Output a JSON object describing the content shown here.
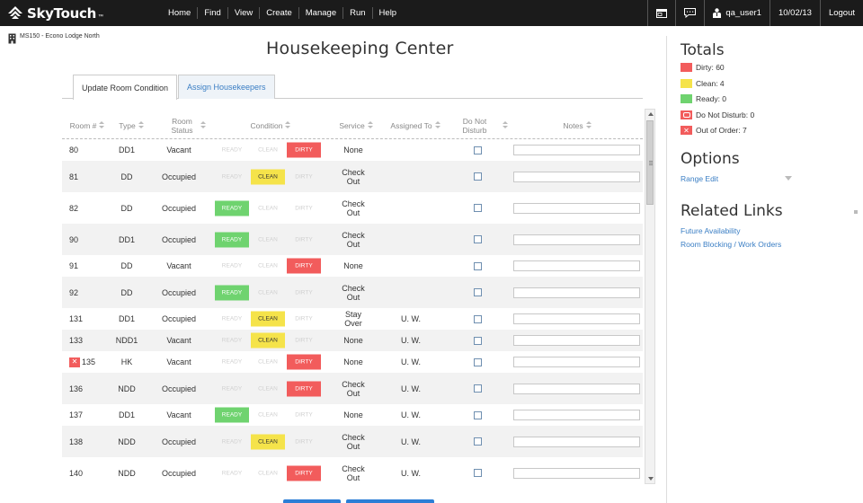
{
  "brand": {
    "name": "SkyTouch",
    "tm": "™"
  },
  "nav": [
    "Home",
    "Find",
    "View",
    "Create",
    "Manage",
    "Run",
    "Help"
  ],
  "right_nav": {
    "user": "qa_user1",
    "date": "10/02/13",
    "logout": "Logout",
    "icons": [
      "window-icon",
      "chat-icon",
      "user-icon"
    ]
  },
  "property": "MS150 - Econo Lodge North",
  "title": "Housekeeping Center",
  "tabs": [
    "Update Room Condition",
    "Assign Housekeepers"
  ],
  "headers": {
    "room": "Room #",
    "type": "Type",
    "status": "Room Status",
    "condition": "Condition",
    "service": "Service",
    "assigned": "Assigned To",
    "dnd": "Do Not Disturb",
    "notes": "Notes"
  },
  "cond_labels": {
    "ready": "READY",
    "clean": "CLEAN",
    "dirty": "DIRTY"
  },
  "colors": {
    "dirty": "#f25c5c",
    "clean": "#f5e34a",
    "ready": "#6fd36f",
    "link": "#3a7ec4"
  },
  "rows": [
    {
      "room": "80",
      "type": "DD1",
      "status": "Vacant",
      "condition": "dirty",
      "service": "None",
      "assigned": "",
      "ooo": false
    },
    {
      "room": "81",
      "type": "DD",
      "status": "Occupied",
      "condition": "clean",
      "service": "Check Out",
      "assigned": "",
      "ooo": false
    },
    {
      "room": "82",
      "type": "DD",
      "status": "Occupied",
      "condition": "ready",
      "service": "Check Out",
      "assigned": "",
      "ooo": false
    },
    {
      "room": "90",
      "type": "DD1",
      "status": "Occupied",
      "condition": "ready",
      "service": "Check Out",
      "assigned": "",
      "ooo": false
    },
    {
      "room": "91",
      "type": "DD",
      "status": "Vacant",
      "condition": "dirty",
      "service": "None",
      "assigned": "",
      "ooo": false
    },
    {
      "room": "92",
      "type": "DD",
      "status": "Occupied",
      "condition": "ready",
      "service": "Check Out",
      "assigned": "",
      "ooo": false
    },
    {
      "room": "131",
      "type": "DD1",
      "status": "Occupied",
      "condition": "clean",
      "service": "Stay Over",
      "assigned": "U. W.",
      "ooo": false
    },
    {
      "room": "133",
      "type": "NDD1",
      "status": "Vacant",
      "condition": "clean",
      "service": "None",
      "assigned": "U. W.",
      "ooo": false
    },
    {
      "room": "135",
      "type": "HK",
      "status": "Vacant",
      "condition": "dirty",
      "service": "None",
      "assigned": "U. W.",
      "ooo": true
    },
    {
      "room": "136",
      "type": "NDD",
      "status": "Occupied",
      "condition": "dirty",
      "service": "Check Out",
      "assigned": "U. W.",
      "ooo": false
    },
    {
      "room": "137",
      "type": "DD1",
      "status": "Vacant",
      "condition": "ready",
      "service": "None",
      "assigned": "U. W.",
      "ooo": false
    },
    {
      "room": "138",
      "type": "NDD",
      "status": "Occupied",
      "condition": "clean",
      "service": "Check Out",
      "assigned": "U. W.",
      "ooo": false
    },
    {
      "room": "140",
      "type": "NDD",
      "status": "Occupied",
      "condition": "dirty",
      "service": "Check Out",
      "assigned": "U. W.",
      "ooo": false
    }
  ],
  "totals": {
    "heading": "Totals",
    "items": [
      {
        "label": "Dirty: 60",
        "kind": "dirty"
      },
      {
        "label": "Clean: 4",
        "kind": "clean"
      },
      {
        "label": "Ready: 0",
        "kind": "ready"
      },
      {
        "label": "Do Not Disturb: 0",
        "kind": "dnd"
      },
      {
        "label": "Out of Order: 7",
        "kind": "ooo"
      }
    ]
  },
  "options": {
    "heading": "Options",
    "range_edit": "Range Edit"
  },
  "related": {
    "heading": "Related Links",
    "links": [
      "Future Availability",
      "Room Blocking / Work Orders"
    ]
  }
}
